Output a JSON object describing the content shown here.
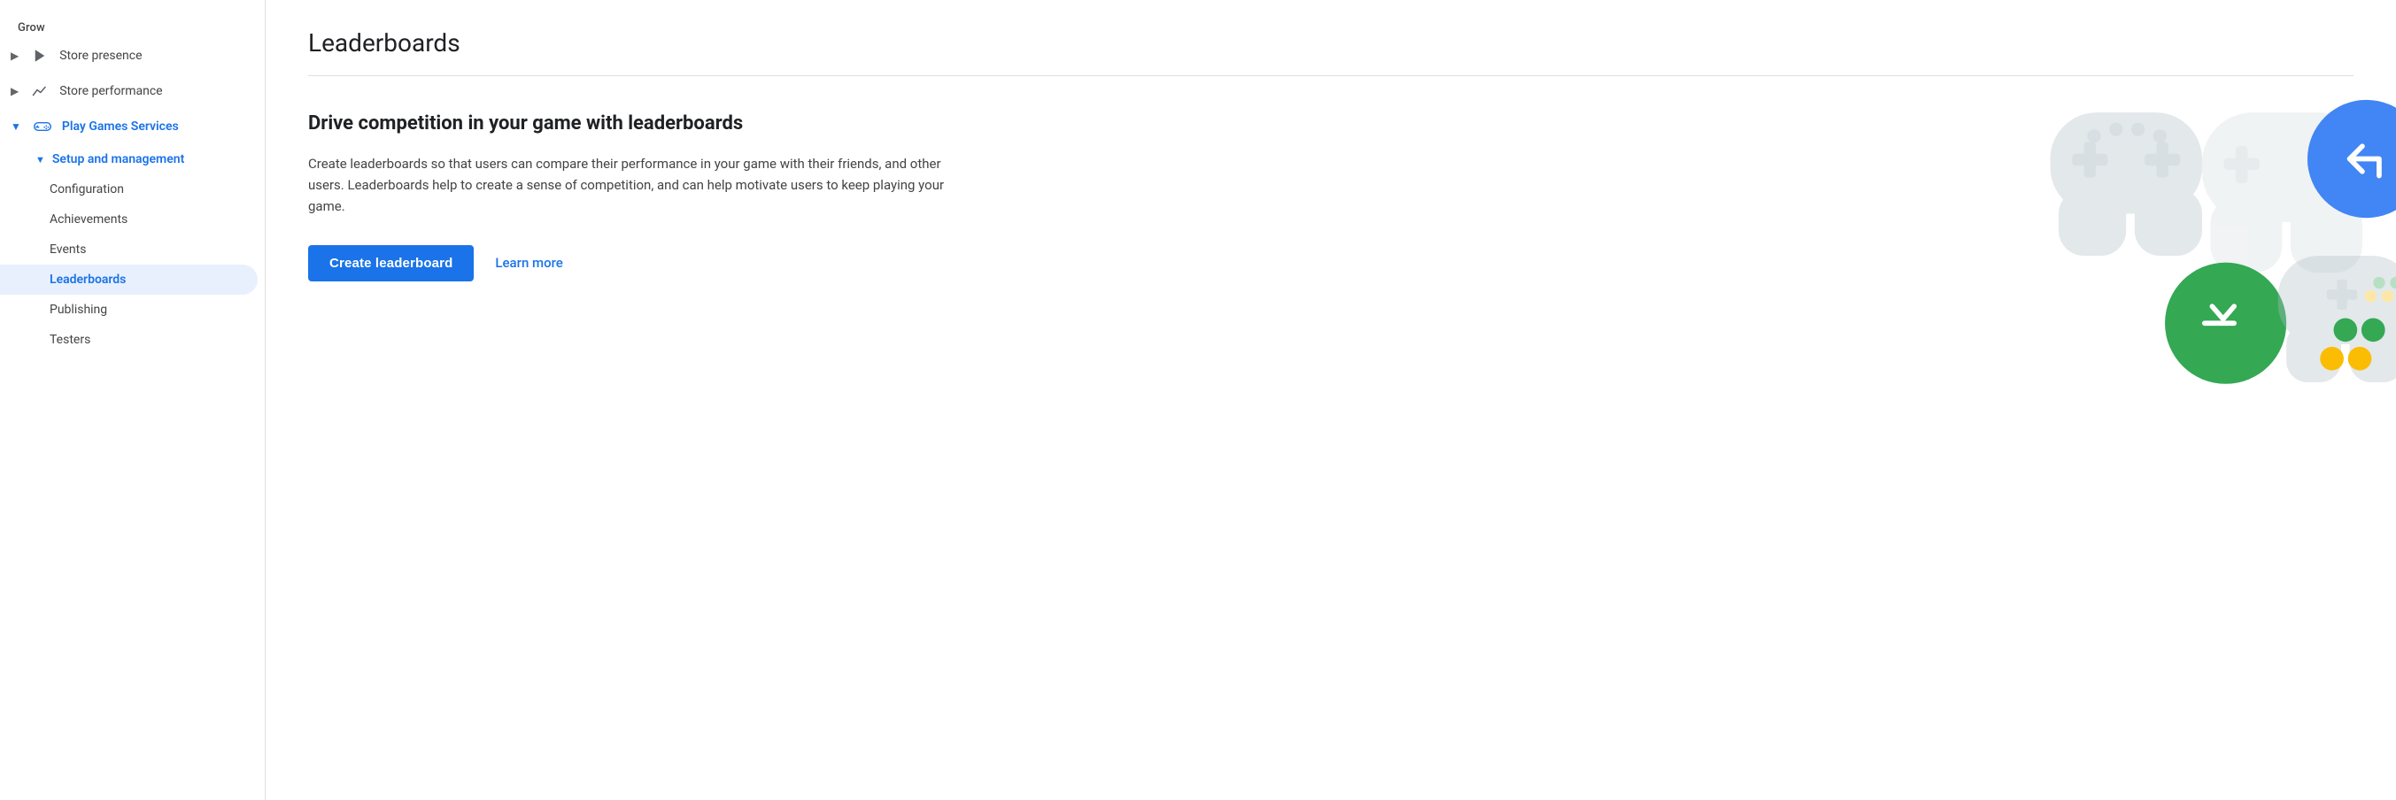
{
  "sidebar": {
    "grow_label": "Grow",
    "items": [
      {
        "id": "store-presence",
        "label": "Store presence",
        "icon": "play-triangle",
        "expandable": true,
        "expanded": false
      },
      {
        "id": "store-performance",
        "label": "Store performance",
        "icon": "trend-up",
        "expandable": true,
        "expanded": false
      },
      {
        "id": "play-games-services",
        "label": "Play Games Services",
        "icon": "gamepad",
        "expandable": true,
        "expanded": true,
        "active_text": true
      }
    ],
    "subitems": {
      "play-games-services": {
        "setup_label": "Setup and management",
        "children": [
          {
            "id": "configuration",
            "label": "Configuration"
          },
          {
            "id": "achievements",
            "label": "Achievements"
          },
          {
            "id": "events",
            "label": "Events"
          },
          {
            "id": "leaderboards",
            "label": "Leaderboards",
            "active": true
          },
          {
            "id": "publishing",
            "label": "Publishing"
          },
          {
            "id": "testers",
            "label": "Testers"
          }
        ]
      }
    }
  },
  "main": {
    "page_title": "Leaderboards",
    "content_heading": "Drive competition in your game with leaderboards",
    "content_description": "Create leaderboards so that users can compare their performance in your game with their friends, and other users. Leaderboards help to create a sense of competition, and can help motivate users to keep playing your game.",
    "create_button_label": "Create leaderboard",
    "learn_more_label": "Learn more"
  },
  "colors": {
    "primary": "#1a73e8",
    "active_bg": "#e8f0fe",
    "text_primary": "#202124",
    "text_secondary": "#444",
    "border": "#e0e0e0",
    "green": "#34a853",
    "blue": "#4285f4",
    "yellow": "#fbbc04",
    "icon_gray": "#9aa0a6"
  }
}
